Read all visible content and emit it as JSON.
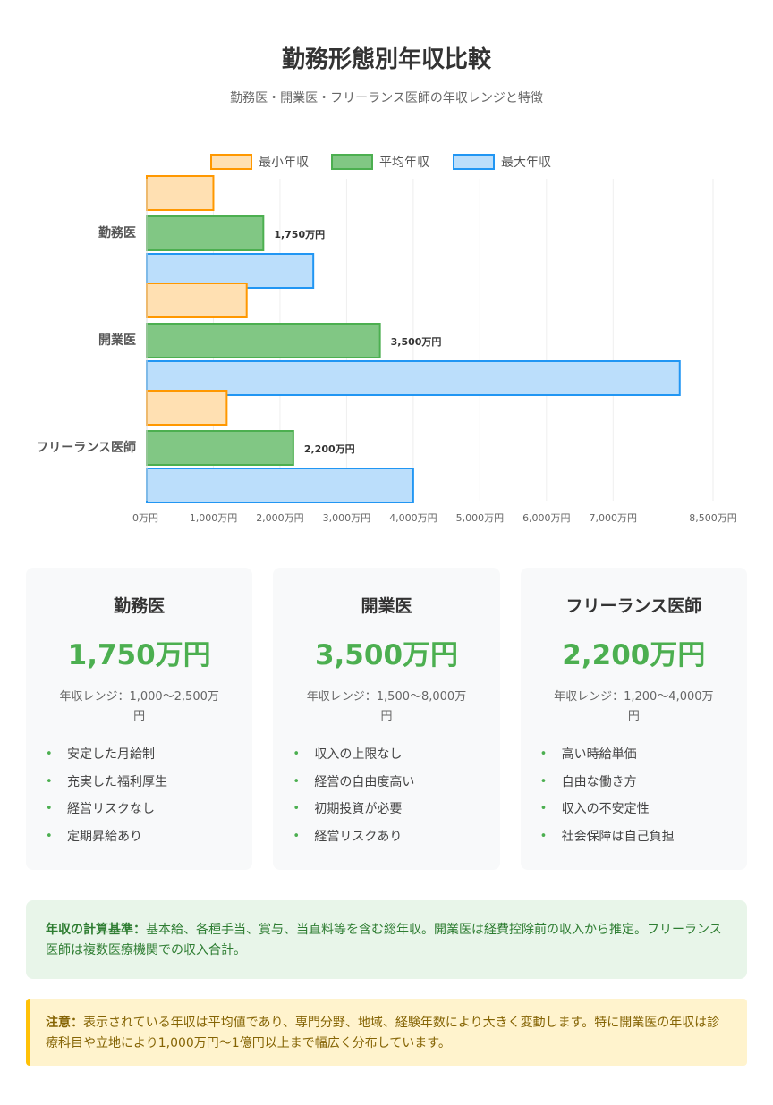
{
  "header": {
    "title": "勤務形態別年収比較",
    "subtitle": "勤務医・開業医・フリーランス医師の年収レンジと特徴"
  },
  "chart_data": {
    "type": "bar",
    "orientation": "horizontal",
    "categories": [
      "勤務医",
      "開業医",
      "フリーランス医師"
    ],
    "series": [
      {
        "name": "最小年収",
        "values": [
          1000,
          1500,
          1200
        ],
        "color": "#ffe0b2",
        "border": "#ff9800"
      },
      {
        "name": "平均年収",
        "values": [
          1750,
          3500,
          2200
        ],
        "color": "#81c784",
        "border": "#4caf50"
      },
      {
        "name": "最大年収",
        "values": [
          2500,
          8000,
          4000
        ],
        "color": "#bbdefb",
        "border": "#2196f3"
      }
    ],
    "data_labels": [
      "1,750万円",
      "3,500万円",
      "2,200万円"
    ],
    "x_ticks": [
      {
        "value": 0,
        "label": "0万円"
      },
      {
        "value": 1000,
        "label": "1,000万円"
      },
      {
        "value": 2000,
        "label": "2,000万円"
      },
      {
        "value": 3000,
        "label": "3,000万円"
      },
      {
        "value": 4000,
        "label": "4,000万円"
      },
      {
        "value": 5000,
        "label": "5,000万円"
      },
      {
        "value": 6000,
        "label": "6,000万円"
      },
      {
        "value": 7000,
        "label": "7,000万円"
      },
      {
        "value": 8500,
        "label": "8,500万円"
      }
    ],
    "xlim": [
      0,
      8500
    ],
    "legend_position": "top",
    "grid": true
  },
  "cards": [
    {
      "title": "勤務医",
      "average": "1,750万円",
      "range_line1": "年収レンジ：1,000〜2,500万",
      "range_line2": "円",
      "features": [
        "安定した月給制",
        "充実した福利厚生",
        "経営リスクなし",
        "定期昇給あり"
      ]
    },
    {
      "title": "開業医",
      "average": "3,500万円",
      "range_line1": "年収レンジ：1,500〜8,000万",
      "range_line2": "円",
      "features": [
        "収入の上限なし",
        "経営の自由度高い",
        "初期投資が必要",
        "経営リスクあり"
      ]
    },
    {
      "title": "フリーランス医師",
      "average": "2,200万円",
      "range_line1": "年収レンジ：1,200〜4,000万",
      "range_line2": "円",
      "features": [
        "高い時給単価",
        "自由な働き方",
        "収入の不安定性",
        "社会保障は自己負担"
      ]
    }
  ],
  "notes": {
    "calc_label": "年収の計算基準：",
    "calc_text": "基本給、各種手当、賞与、当直料等を含む総年収。開業医は経費控除前の収入から推定。フリーランス医師は複数医療機関での収入合計。",
    "caution_label": "注意：",
    "caution_text": "表示されている年収は平均値であり、専門分野、地域、経験年数により大きく変動します。特に開業医の年収は診療科目や立地により1,000万円〜1億円以上まで幅広く分布しています。"
  },
  "colors": {
    "accent_green": "#4caf50",
    "note_green_bg": "#e8f5e9",
    "note_yellow_bg": "#fff3cd",
    "note_yellow_border": "#ffc107"
  }
}
